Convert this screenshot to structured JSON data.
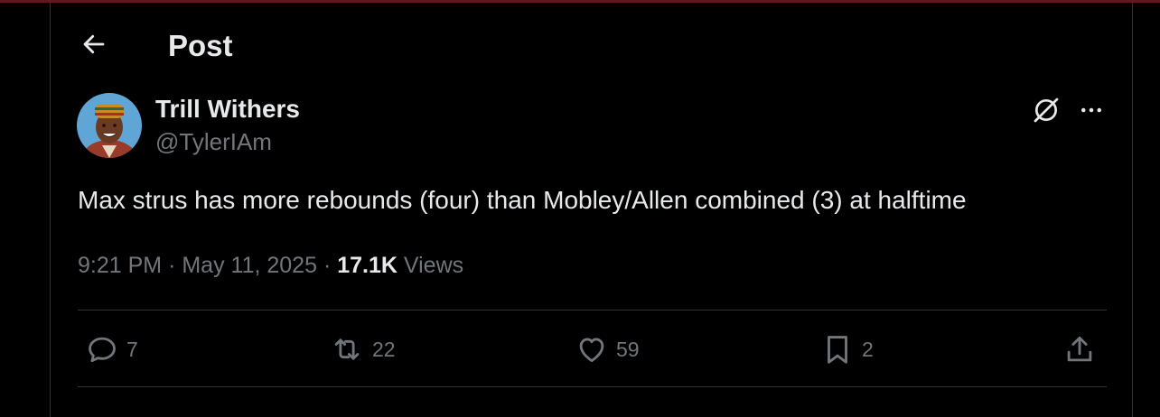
{
  "header": {
    "title": "Post"
  },
  "author": {
    "name": "Trill Withers",
    "handle": "@TylerIAm"
  },
  "tweet": {
    "text": "Max strus has more rebounds (four) than Mobley/Allen combined (3) at halftime"
  },
  "meta": {
    "time": "9:21 PM",
    "date": "May 11, 2025",
    "separator": "·",
    "views_count": "17.1K",
    "views_label": "Views"
  },
  "actions": {
    "replies": "7",
    "reposts": "22",
    "likes": "59",
    "bookmarks": "2"
  },
  "icons": {
    "back": "arrow-left-icon",
    "grok": "grok-icon",
    "more": "more-dots-icon",
    "reply": "reply-icon",
    "repost": "repost-icon",
    "like": "heart-icon",
    "bookmark": "bookmark-icon",
    "share": "share-icon"
  },
  "colors": {
    "background": "#000000",
    "text": "#e7e9ea",
    "muted": "#71767b",
    "border": "#2f3336",
    "topbar": "#5e1a1f"
  }
}
